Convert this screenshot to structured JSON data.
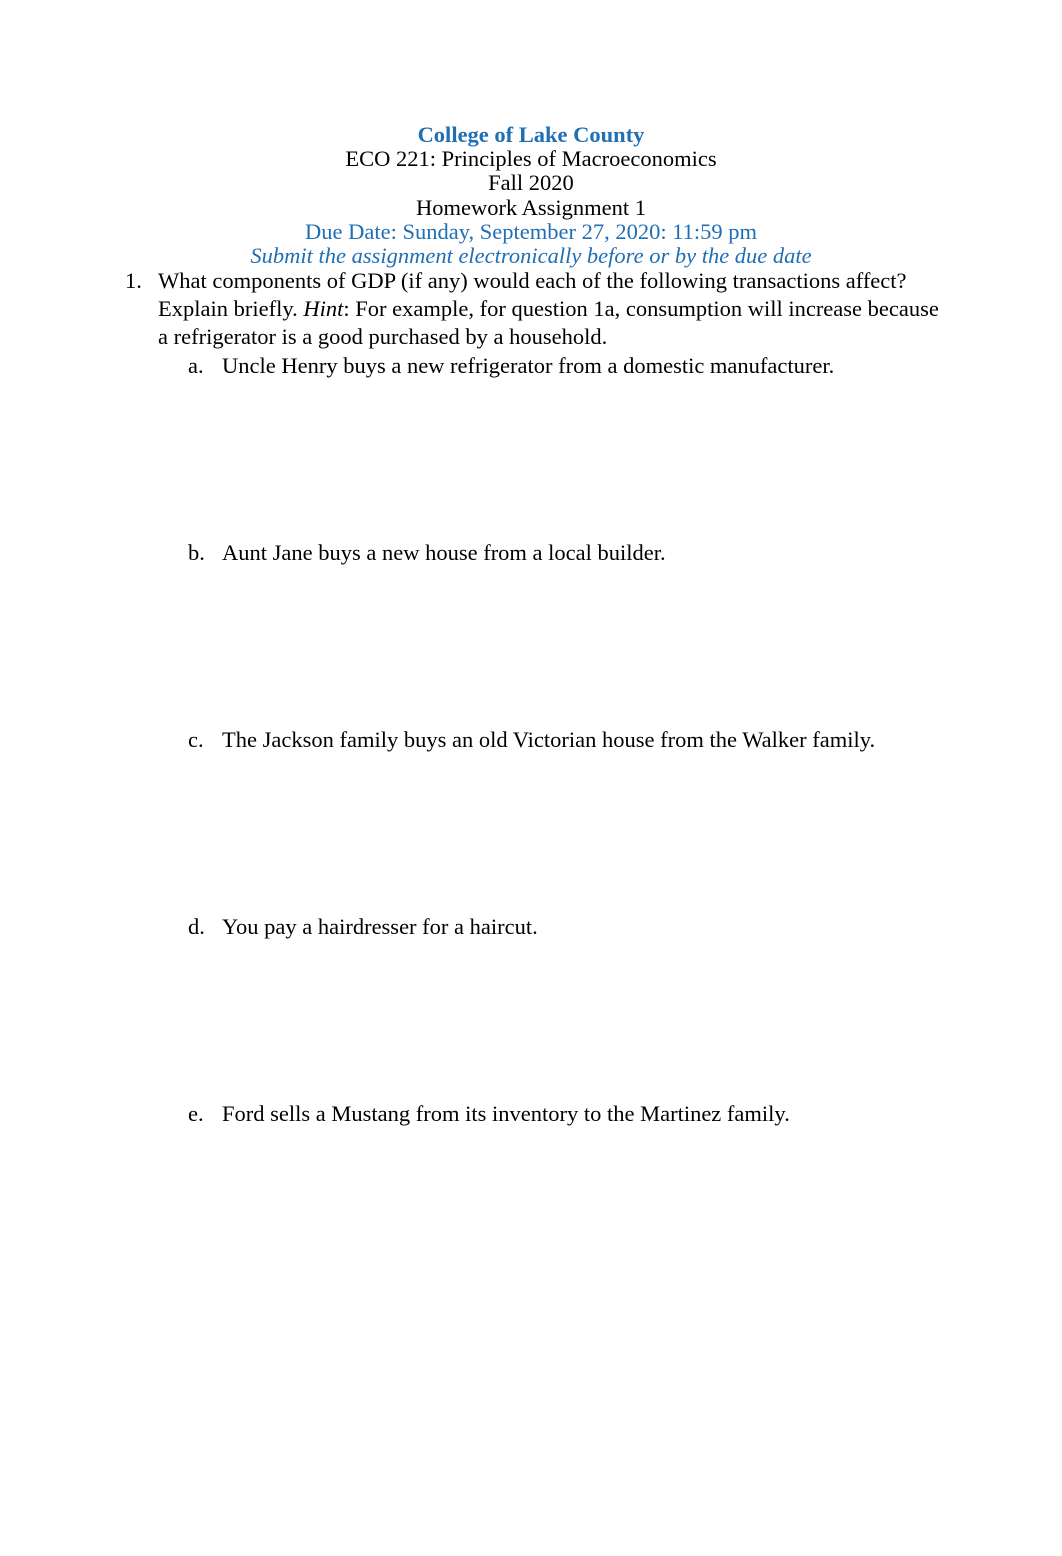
{
  "document": {
    "header": {
      "institution": "College of Lake County",
      "course": "ECO 221: Principles of Macroeconomics",
      "term": "Fall 2020",
      "assignment": "Homework Assignment 1",
      "due_date": "Due Date: Sunday, September 27, 2020: 11:59 pm",
      "submit_note": "Submit the assignment electronically before or by the due date"
    },
    "colors": {
      "heading_blue": "#1f6fb5",
      "body_black": "#000000",
      "page_background": "#ffffff"
    },
    "questions": [
      {
        "marker": "1.",
        "text_before_hint": "What components of GDP (if any) would each of the following transactions affect? Explain briefly. ",
        "hint_label": "Hint",
        "text_after_hint": ": For example, for question 1a, consumption will increase because a refrigerator is a good purchased by a household.",
        "sub_items": [
          {
            "marker": "a.",
            "text": "Uncle Henry buys a new refrigerator from a domestic manufacturer."
          },
          {
            "marker": "b.",
            "text": "Aunt Jane buys a new house from a local builder."
          },
          {
            "marker": "c.",
            "text": "The Jackson family buys an old Victorian house from the Walker family."
          },
          {
            "marker": "d.",
            "text": "You pay a hairdresser for a haircut."
          },
          {
            "marker": "e.",
            "text": "Ford sells a Mustang from its inventory to the Martinez family."
          }
        ]
      }
    ]
  }
}
